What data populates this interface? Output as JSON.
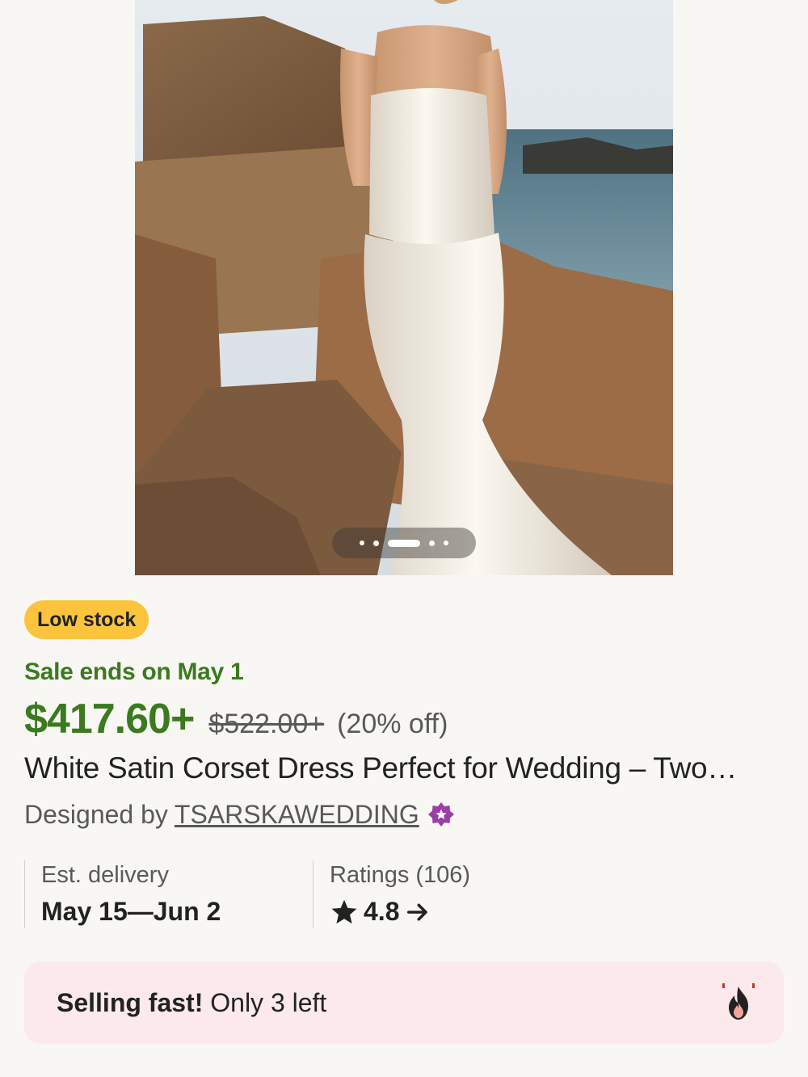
{
  "product_image": {
    "alt": "White satin corset dress on a model by the seaside rocks",
    "carousel": {
      "total": 5,
      "active_index": 2
    }
  },
  "badge": {
    "label": "Low stock",
    "color": "#fcc43c"
  },
  "sale": {
    "ends_text": "Sale ends on May 1",
    "color": "#3b7a1f"
  },
  "price": {
    "current": "$417.60+",
    "original": "$522.00+",
    "discount": "(20% off)"
  },
  "title": "White Satin Corset Dress Perfect for Wedding – Two…",
  "designer": {
    "prefix": "Designed by",
    "shop_name": "TSARSKAWEDDING",
    "star_seller_icon": "star-seller-icon",
    "star_seller_color": "#9b3fa8"
  },
  "stats": {
    "delivery": {
      "label": "Est. delivery",
      "value": "May 15—Jun 2"
    },
    "ratings": {
      "label": "Ratings (106)",
      "value": "4.8",
      "icon": "star-icon",
      "arrow_icon": "arrow-right-icon"
    }
  },
  "alert": {
    "strong": "Selling fast!",
    "rest": "Only 3 left",
    "icon": "fire-icon",
    "background": "#fbe9eb"
  }
}
